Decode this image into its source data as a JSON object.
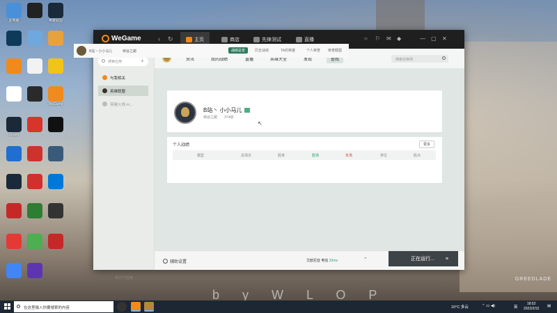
{
  "desktop": {
    "icons": [
      {
        "label": "此电脑",
        "color": "#4a90d9"
      },
      {
        "label": "",
        "color": "#222222"
      },
      {
        "label": "英雄联盟",
        "color": "#1a2a3a"
      },
      {
        "label": "",
        "color": "#0e3a5a"
      },
      {
        "label": "",
        "color": "#6fa8dc"
      },
      {
        "label": "",
        "color": "#e6a23c"
      },
      {
        "label": "",
        "color": "#f08a1c"
      },
      {
        "label": "",
        "color": "#f2f2f2"
      },
      {
        "label": "",
        "color": "#f0c419"
      },
      {
        "label": "",
        "color": "#ffffff"
      },
      {
        "label": "",
        "color": "#2a2a2a"
      },
      {
        "label": "WeGame",
        "color": "#f08a1c"
      },
      {
        "label": "Steam",
        "color": "#1b2838"
      },
      {
        "label": "",
        "color": "#d9342b"
      },
      {
        "label": "",
        "color": "#111111"
      },
      {
        "label": "",
        "color": "#1f6fd1"
      },
      {
        "label": "",
        "color": "#d0312d"
      },
      {
        "label": "",
        "color": "#3a5a7a"
      },
      {
        "label": "",
        "color": "#1a2a3a"
      },
      {
        "label": "",
        "color": "#d0312d"
      },
      {
        "label": "",
        "color": "#0078d7"
      },
      {
        "label": "",
        "color": "#c62828"
      },
      {
        "label": "",
        "color": "#2e7d32"
      },
      {
        "label": "",
        "color": "#333333"
      },
      {
        "label": "",
        "color": "#e53935"
      },
      {
        "label": "",
        "color": "#4caf50"
      },
      {
        "label": "",
        "color": "#c62828"
      },
      {
        "label": "",
        "color": "#4285f4"
      },
      {
        "label": "",
        "color": "#5e35b1"
      }
    ],
    "watermark": "b y W L O P",
    "brand": "GREEDLADE"
  },
  "window": {
    "logo": "WeGame",
    "nav": [
      {
        "label": "主页",
        "color": "#f08a1c"
      },
      {
        "label": "商店",
        "color": "#888888"
      },
      {
        "label": "先锋测试",
        "color": "#888888"
      },
      {
        "label": "直播",
        "color": "#888888"
      }
    ],
    "controls": [
      "○",
      "⚐",
      "✉",
      "◆",
      "—",
      "▢",
      "✕"
    ]
  },
  "sidebar": {
    "search_placeholder": "搜索应用",
    "items": [
      {
        "label": "与我相关",
        "color": "#f08a1c"
      },
      {
        "label": "英雄联盟",
        "color": "#3a3226"
      },
      {
        "label": "穿越火线·H...",
        "color": "#bbbbbb"
      }
    ],
    "footer": "共27个应用"
  },
  "game": {
    "tabs": [
      "资讯",
      "我的战绩",
      "直播",
      "英雄大全",
      "发现",
      "查找"
    ],
    "search_placeholder": "搜索召唤师",
    "subbar": {
      "player": "B站丶小小马儿",
      "server": "峡谷之巅",
      "tabs": [
        "战绩总览",
        "历史战绩",
        "TA的英雄",
        "个人荣誉",
        "荣誉截图"
      ]
    },
    "profile": {
      "name": "B站丶 小小马儿",
      "server": "峡谷之巅",
      "level": "374级"
    },
    "stats": {
      "title": "个人战绩",
      "more": "更多",
      "headers": [
        "模型",
        "总场次",
        "胜率",
        "胜场",
        "负场",
        "排位",
        "胜点"
      ]
    }
  },
  "bottombar": {
    "assist": "辅助设置",
    "status_prefix": "艾欧尼亚 电信",
    "status_ok": "33ms",
    "running": "正在运行..."
  },
  "taskbar": {
    "search_placeholder": "在这里输入你要搜索的内容",
    "weather": "10°C 多云",
    "time": "18:52",
    "date": "2022/2/15",
    "ime": "英"
  }
}
